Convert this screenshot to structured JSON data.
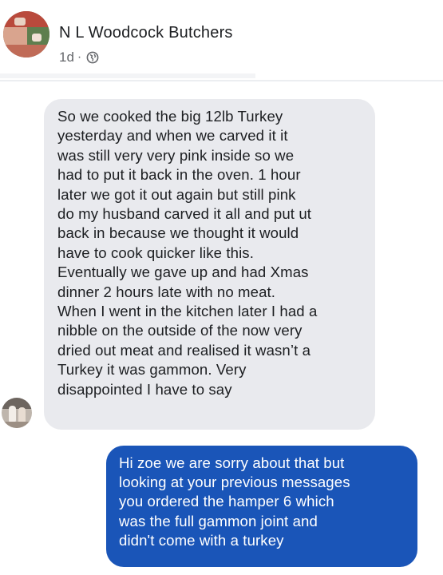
{
  "post": {
    "page_name": "N L Woodcock Butchers",
    "time": "1d",
    "separator": "·",
    "visibility_icon": "globe-icon"
  },
  "messages": [
    {
      "direction": "incoming",
      "lines": [
        "So we cooked the big 12lb Turkey",
        "yesterday and when we carved it it",
        "was still very very pink inside so we",
        "had to put it back in the oven. 1 hour",
        "later we got it out again but still pink",
        "do my husband carved it all and put ut",
        "back in because we thought it would",
        "have to cook quicker like this.",
        "Eventually we gave up and had Xmas",
        "dinner 2 hours late with no meat.",
        "When I went in the kitchen later I had a",
        "nibble on the outside of the now very",
        "dried out meat and realised it wasn’t a",
        "Turkey it was gammon. Very",
        "disappointed I have to say"
      ]
    },
    {
      "direction": "outgoing",
      "lines": [
        "Hi zoe we are sorry about that but",
        "looking at your previous messages",
        "you ordered the hamper 6 which",
        "was the full gammon joint and",
        "didn't come with a turkey"
      ]
    }
  ],
  "colors": {
    "incoming_bubble": "#e9eaee",
    "outgoing_bubble": "#1a55b8",
    "meta_text": "#65676b"
  }
}
